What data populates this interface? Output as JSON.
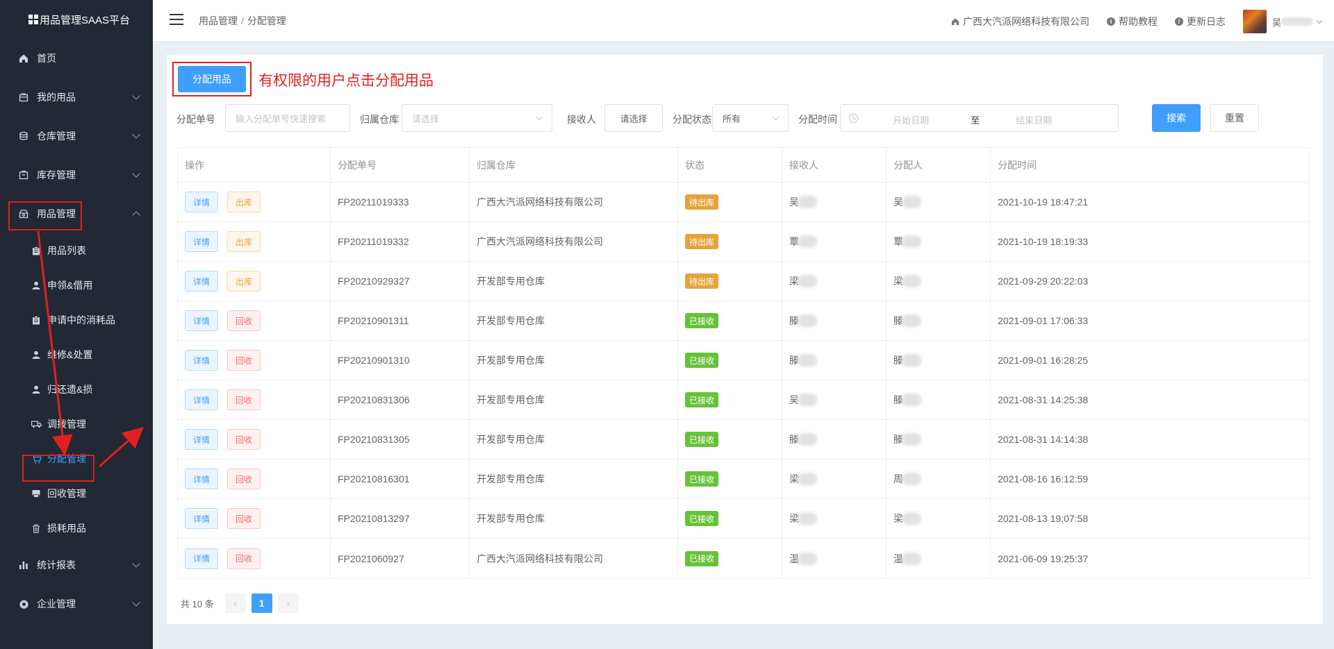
{
  "app": {
    "title": "用品管理SAAS平台"
  },
  "sidebar": {
    "items": [
      {
        "label": "首页",
        "icon": "home-icon",
        "has_children": false
      },
      {
        "label": "我的用品",
        "icon": "bag-icon",
        "has_children": true
      },
      {
        "label": "仓库管理",
        "icon": "database-icon",
        "has_children": true
      },
      {
        "label": "库存管理",
        "icon": "box-icon",
        "has_children": true
      },
      {
        "label": "用品管理",
        "icon": "package-icon",
        "has_children": true,
        "expanded": true
      }
    ],
    "sub_items": [
      {
        "label": "用品列表",
        "icon": "clipboard-icon"
      },
      {
        "label": "申领&借用",
        "icon": "user-icon"
      },
      {
        "label": "申请中的消耗品",
        "icon": "clipboard-icon"
      },
      {
        "label": "维修&处置",
        "icon": "user-icon"
      },
      {
        "label": "归还遗&损",
        "icon": "user-icon"
      },
      {
        "label": "调拨管理",
        "icon": "truck-icon"
      },
      {
        "label": "分配管理",
        "icon": "cart-icon",
        "active": true
      },
      {
        "label": "回收管理",
        "icon": "printer-icon"
      },
      {
        "label": "损耗用品",
        "icon": "trash-icon"
      }
    ],
    "bottom_items": [
      {
        "label": "统计报表",
        "icon": "bar-chart-icon",
        "has_children": true
      },
      {
        "label": "企业管理",
        "icon": "gear-icon",
        "has_children": true
      }
    ]
  },
  "header": {
    "breadcrumb": [
      "用品管理",
      "分配管理"
    ],
    "breadcrumb_sep": "/",
    "company": "广西大汽派网络科技有限公司",
    "help": "帮助教程",
    "changelog": "更新日志",
    "user_initial": "吴"
  },
  "toolbar": {
    "assign_label": "分配用品",
    "annotation": "有权限的用户点击分配用品"
  },
  "filters": {
    "no_label": "分配单号",
    "no_placeholder": "输入分配单号快速搜索",
    "warehouse_label": "归属仓库",
    "warehouse_placeholder": "请选择",
    "receiver_label": "接收人",
    "receiver_button": "请选择",
    "status_label": "分配状态",
    "status_value": "所有",
    "time_label": "分配时间",
    "date_start": "开始日期",
    "date_sep": "至",
    "date_end": "结束日期",
    "search": "搜索",
    "reset": "重置"
  },
  "table": {
    "columns": [
      "操作",
      "分配单号",
      "归属仓库",
      "状态",
      "接收人",
      "分配人",
      "分配时间"
    ],
    "detail_label": "详情",
    "rows": [
      {
        "action": "出库",
        "action_type": "out",
        "no": "FP20211019333",
        "warehouse": "广西大汽派网络科技有限公司",
        "status": "待出库",
        "status_type": "wait",
        "receiver": "吴",
        "assigner": "吴",
        "time": "2021-10-19 18:47:21"
      },
      {
        "action": "出库",
        "action_type": "out",
        "no": "FP20211019332",
        "warehouse": "广西大汽派网络科技有限公司",
        "status": "待出库",
        "status_type": "wait",
        "receiver": "覃",
        "assigner": "覃",
        "time": "2021-10-19 18:19:33"
      },
      {
        "action": "出库",
        "action_type": "out",
        "no": "FP20210929327",
        "warehouse": "开发部专用仓库",
        "status": "待出库",
        "status_type": "wait",
        "receiver": "梁",
        "assigner": "梁",
        "time": "2021-09-29 20:22:03"
      },
      {
        "action": "回收",
        "action_type": "recycle",
        "no": "FP20210901311",
        "warehouse": "开发部专用仓库",
        "status": "已接收",
        "status_type": "done",
        "receiver": "滕",
        "assigner": "滕",
        "time": "2021-09-01 17:06:33"
      },
      {
        "action": "回收",
        "action_type": "recycle",
        "no": "FP20210901310",
        "warehouse": "开发部专用仓库",
        "status": "已接收",
        "status_type": "done",
        "receiver": "滕",
        "assigner": "滕",
        "time": "2021-09-01 16:28:25"
      },
      {
        "action": "回收",
        "action_type": "recycle",
        "no": "FP20210831306",
        "warehouse": "开发部专用仓库",
        "status": "已接收",
        "status_type": "done",
        "receiver": "吴",
        "assigner": "滕",
        "time": "2021-08-31 14:25:38"
      },
      {
        "action": "回收",
        "action_type": "recycle",
        "no": "FP20210831305",
        "warehouse": "开发部专用仓库",
        "status": "已接收",
        "status_type": "done",
        "receiver": "滕",
        "assigner": "滕",
        "time": "2021-08-31 14:14:38"
      },
      {
        "action": "回收",
        "action_type": "recycle",
        "no": "FP20210816301",
        "warehouse": "开发部专用仓库",
        "status": "已接收",
        "status_type": "done",
        "receiver": "梁",
        "assigner": "周",
        "time": "2021-08-16 16:12:59"
      },
      {
        "action": "回收",
        "action_type": "recycle",
        "no": "FP20210813297",
        "warehouse": "开发部专用仓库",
        "status": "已接收",
        "status_type": "done",
        "receiver": "梁",
        "assigner": "梁",
        "time": "2021-08-13 19:07:58"
      },
      {
        "action": "回收",
        "action_type": "recycle",
        "no": "FP2021060927",
        "warehouse": "广西大汽派网络科技有限公司",
        "status": "已接收",
        "status_type": "done",
        "receiver": "温",
        "assigner": "温",
        "time": "2021-06-09 19:25:37"
      }
    ]
  },
  "pagination": {
    "total": "共 10 条",
    "current": "1",
    "prev": "‹",
    "next": "›"
  },
  "colors": {
    "primary": "#409eff",
    "annotation": "#e02020",
    "sidebar_bg": "#222834",
    "warning": "#e6a23c",
    "success": "#67c23a"
  }
}
